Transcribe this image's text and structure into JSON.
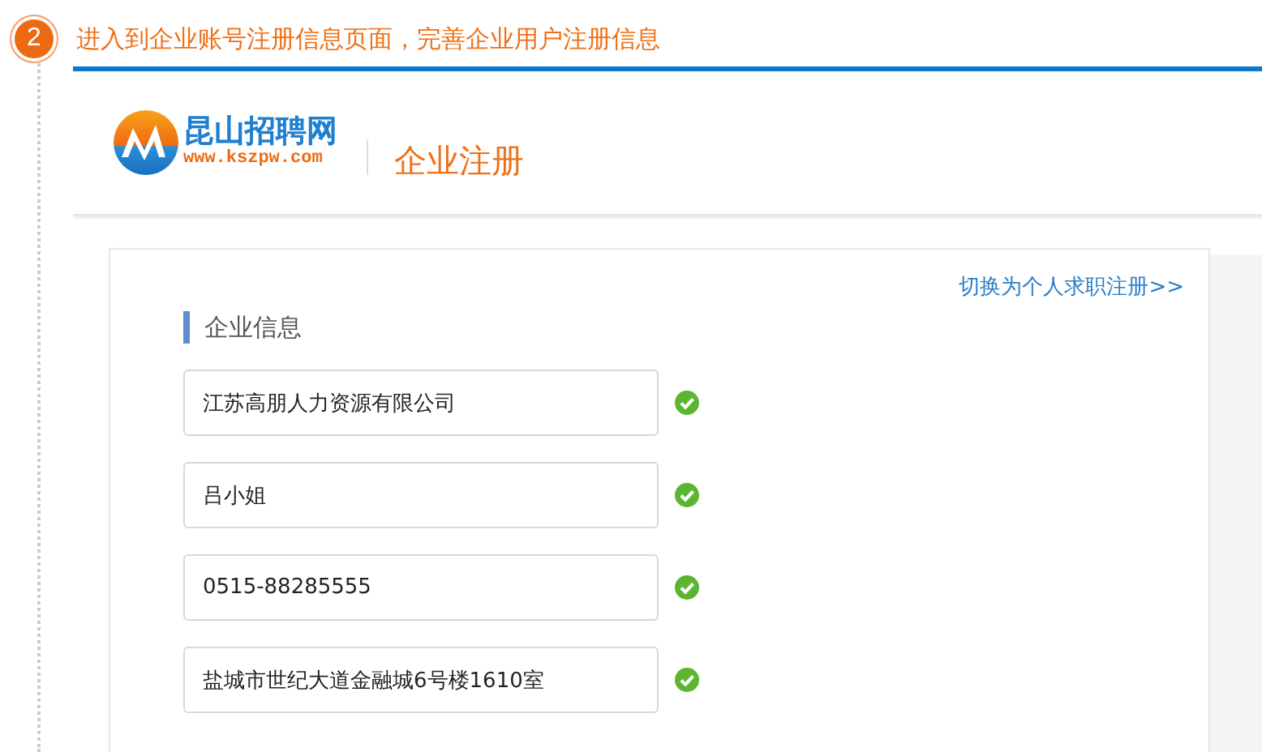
{
  "step": {
    "number": "2",
    "title": "进入到企业账号注册信息页面，完善企业用户注册信息"
  },
  "header": {
    "logo_name": "昆山招聘网",
    "logo_url": "www.kszpw.com",
    "page_title": "企业注册"
  },
  "form": {
    "switch_link": "切换为个人求职注册>>",
    "section_title": "企业信息",
    "fields": [
      {
        "value": "江苏高朋人力资源有限公司",
        "valid": true
      },
      {
        "value": "吕小姐",
        "valid": true
      },
      {
        "value": "0515-88285555",
        "valid": true
      },
      {
        "value": "盐城市世纪大道金融城6号楼1610室",
        "valid": true
      }
    ]
  }
}
